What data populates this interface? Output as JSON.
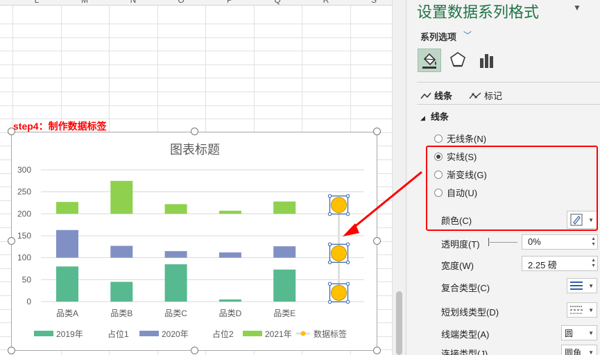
{
  "sheet": {
    "columns": [
      "L",
      "M",
      "N",
      "O",
      "P",
      "Q",
      "R",
      "S"
    ],
    "annotation": "step4：制作数据标签"
  },
  "chart_data": {
    "type": "bar",
    "title": "图表标题",
    "categories": [
      "品类A",
      "品类B",
      "品类C",
      "品类D",
      "品类E"
    ],
    "series": [
      {
        "name": "2019年",
        "values": [
          80,
          45,
          85,
          5,
          73
        ]
      },
      {
        "name": "占位1",
        "values": [
          20,
          55,
          15,
          95,
          27
        ]
      },
      {
        "name": "2020年",
        "values": [
          63,
          27,
          15,
          12,
          26
        ]
      },
      {
        "name": "占位2",
        "values": [
          37,
          73,
          85,
          88,
          74
        ]
      },
      {
        "name": "2021年",
        "values": [
          27,
          75,
          22,
          7,
          28
        ]
      }
    ],
    "label_series": {
      "name": "数据标签",
      "values": [
        20,
        110,
        220
      ]
    },
    "yticks": [
      "0",
      "50",
      "100",
      "150",
      "200",
      "250",
      "300"
    ],
    "ylim": [
      0,
      300
    ],
    "grid": true,
    "legend": "bottom",
    "legend_items": [
      "2019年",
      "占位1",
      "2020年",
      "占位2",
      "2021年",
      "数据标签"
    ],
    "colors": {
      "2019年": "#56b98f",
      "2020年": "#8190c4",
      "2021年": "#8fd14f",
      "数据标签": "#ffc000"
    }
  },
  "pane": {
    "title": "设置数据系列格式",
    "series_options": "系列选项",
    "tabs": {
      "line": "线条",
      "marker": "标记"
    },
    "section": "线条",
    "radios": [
      {
        "label": "无线条(N)",
        "checked": false
      },
      {
        "label": "实线(S)",
        "checked": true
      },
      {
        "label": "渐变线(G)",
        "checked": false
      },
      {
        "label": "自动(U)",
        "checked": false
      }
    ],
    "props": {
      "color": "颜色(C)",
      "transparency": "透明度(T)",
      "transparency_value": "0%",
      "width": "宽度(W)",
      "width_value": "2.25 磅",
      "compound": "复合类型(C)",
      "dash": "短划线类型(D)",
      "cap": "线端类型(A)",
      "cap_value": "圆",
      "join": "连接类型(J)",
      "join_value": "圆角"
    }
  }
}
